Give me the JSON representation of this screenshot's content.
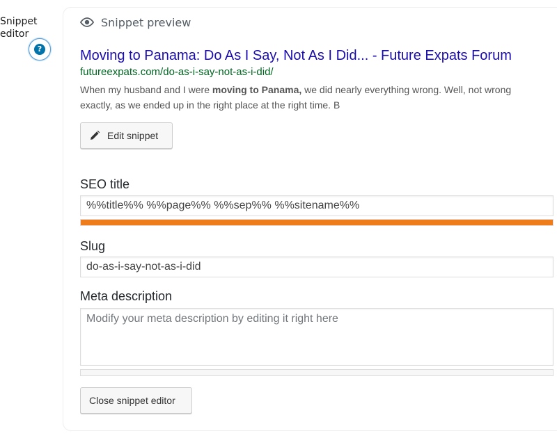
{
  "sidebar_label": "Snippet editor",
  "help_button": {
    "label": "?"
  },
  "preview": {
    "header_label": "Snippet preview",
    "title": "Moving to Panama: Do As I Say, Not As I Did... - Future Expats Forum",
    "url": "futureexpats.com/do-as-i-say-not-as-i-did/",
    "description_before": "When my husband and I were ",
    "description_bold": "moving to Panama,",
    "description_after": " we did nearly everything wrong. Well, not wrong",
    "description_line2": "exactly, as we ended up in the right place at the right time. B"
  },
  "edit_button": {
    "label": "Edit snippet"
  },
  "seo_title": {
    "label": "SEO title",
    "value": "%%title%% %%page%% %%sep%% %%sitename%%",
    "progress": 1.0,
    "progress_color": "#ee7c1b"
  },
  "slug": {
    "label": "Slug",
    "value": "do-as-i-say-not-as-i-did"
  },
  "meta_description": {
    "label": "Meta description",
    "placeholder": "Modify your meta description by editing it right here",
    "progress": 0
  },
  "close_button": {
    "label": "Close snippet editor"
  },
  "colors": {
    "title_link": "#1a0dab",
    "url_green": "#006621",
    "accent_blue": "#0073aa"
  }
}
